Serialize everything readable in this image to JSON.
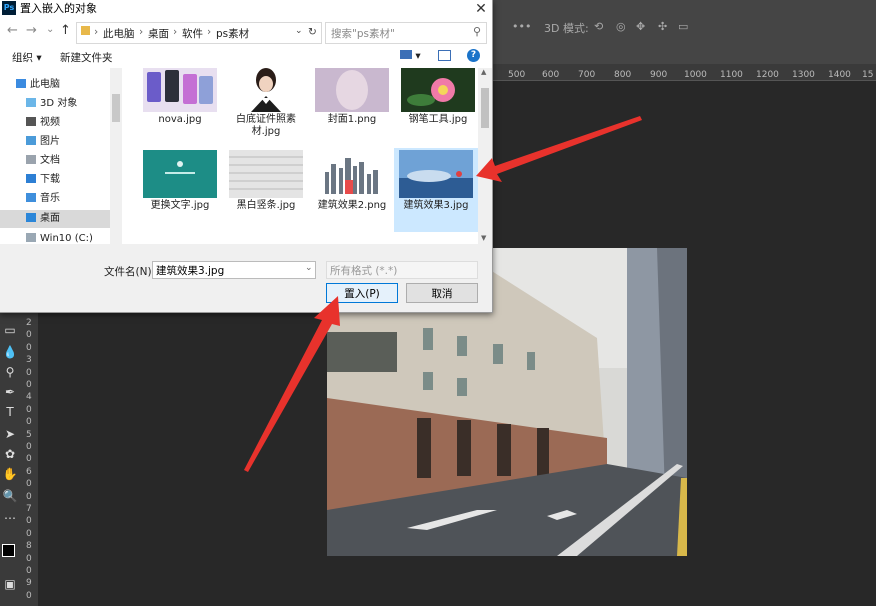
{
  "dialog": {
    "title": "置入嵌入的对象",
    "app_badge": "Ps",
    "close": "✕",
    "nav": {
      "back": "←",
      "forward": "→",
      "dropdown": "⌄",
      "up": "↑",
      "refresh": "↻"
    },
    "breadcrumb": [
      "此电脑",
      "桌面",
      "软件",
      "ps素材"
    ],
    "search_placeholder": "搜索\"ps素材\"",
    "toolbar": {
      "organize": "组织 ▾",
      "new_folder": "新建文件夹",
      "help": "?"
    },
    "nav_items": [
      {
        "label": "此电脑"
      },
      {
        "label": "3D 对象"
      },
      {
        "label": "视频"
      },
      {
        "label": "图片"
      },
      {
        "label": "文档"
      },
      {
        "label": "下载"
      },
      {
        "label": "音乐"
      },
      {
        "label": "桌面"
      },
      {
        "label": "Win10 (C:)"
      }
    ],
    "files": [
      {
        "name": "nova.jpg"
      },
      {
        "name": "白底证件照素材.jpg"
      },
      {
        "name": "封面1.png"
      },
      {
        "name": "钢笔工具.jpg"
      },
      {
        "name": "更换文字.jpg"
      },
      {
        "name": "黑白竖条.jpg"
      },
      {
        "name": "建筑效果2.png"
      },
      {
        "name": "建筑效果3.jpg"
      }
    ],
    "filename_label": "文件名(N):",
    "filename_value": "建筑效果3.jpg",
    "format_value": "所有格式 (*.*)",
    "place_button": "置入(P)",
    "cancel_button": "取消"
  },
  "ps": {
    "options": {
      "more": "•••",
      "mode_3d": "3D 模式:"
    },
    "ruler_ticks": [
      "500",
      "600",
      "700",
      "800",
      "900",
      "1000",
      "1100",
      "1200",
      "1300",
      "1400",
      "15"
    ],
    "left_ruler_digits": [
      "2",
      "0",
      "0",
      "3",
      "0",
      "0",
      "4",
      "0",
      "0",
      "5",
      "0",
      "0",
      "6",
      "0",
      "0",
      "7",
      "0",
      "0",
      "8",
      "0",
      "0",
      "9",
      "0"
    ]
  },
  "colors": {
    "accent": "#0078d7",
    "selection": "#cce8ff",
    "arrow": "#e8322c",
    "ps_bg": "#282828"
  }
}
